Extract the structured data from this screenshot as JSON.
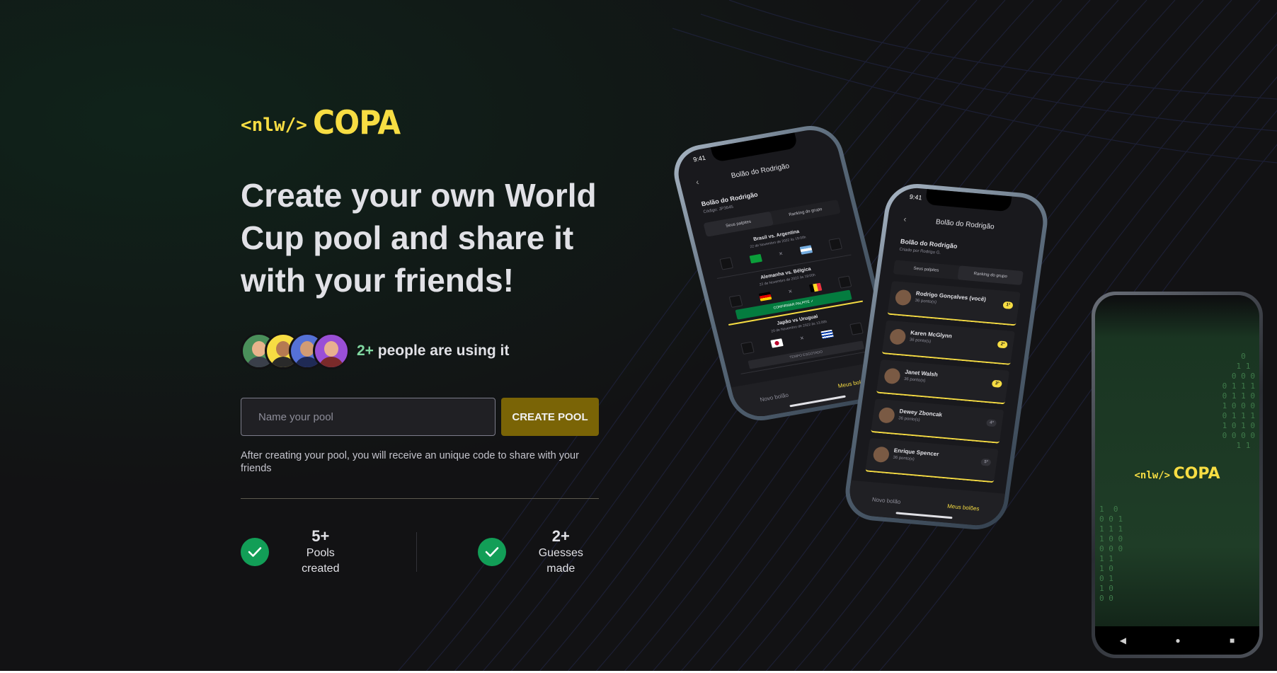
{
  "brand": {
    "prefix": "<nlw/>",
    "name": "COPA"
  },
  "headline": "Create your own World Cup pool and share it with your friends!",
  "users": {
    "count": "2+",
    "text": " people are using it"
  },
  "form": {
    "placeholder": "Name your pool",
    "button_label": "CREATE POOL",
    "hint": "After creating your pool, you will receive an unique code to share with your friends"
  },
  "stats": [
    {
      "value": "5+",
      "label": "Pools created"
    },
    {
      "value": "2+",
      "label": "Guesses made"
    }
  ],
  "colors": {
    "accent": "#F7DD43",
    "button": "#7A6406",
    "success": "#129E57",
    "background": "#121214"
  },
  "phone_left": {
    "time": "9:41",
    "title": "Bolão do Rodrigão",
    "pool_name": "Bolão do Rodrigão",
    "pool_code": "Código: JP3645",
    "tabs": [
      "Seus palpites",
      "Ranking do grupo"
    ],
    "games": [
      {
        "teams": "Brasil vs. Argentina",
        "date": "22 de Novembro de 2022 às 19:00h"
      },
      {
        "teams": "Alemanha vs. Bélgica",
        "date": "22 de Novembro de 2022 às 19:00h"
      },
      {
        "teams": "Japão vs Uruguai",
        "date": "20 de Novembro de 2022 às 13:00h"
      }
    ],
    "confirm_label": "CONFIRMAR PALPITE ✓",
    "expired_label": "TEMPO ESGOTADO",
    "nav": [
      "Novo bolão",
      "Meus bolões"
    ]
  },
  "phone_right": {
    "time": "9:41",
    "title": "Bolão do Rodrigão",
    "pool_name": "Bolão do Rodrigão",
    "pool_sub": "Criado por Rodrigo G.",
    "tabs": [
      "Seus palpites",
      "Ranking do grupo"
    ],
    "ranking": [
      {
        "name": "Rodrigo Gonçalves (você)",
        "points": "36 ponto(s)",
        "position": "1º"
      },
      {
        "name": "Karen McGlynn",
        "points": "36 ponto(s)",
        "position": "2º"
      },
      {
        "name": "Janet Walsh",
        "points": "36 ponto(s)",
        "position": "3º"
      },
      {
        "name": "Dewey Zboncak",
        "points": "36 ponto(s)",
        "position": "4º"
      },
      {
        "name": "Enrique Spencer",
        "points": "36 ponto(s)",
        "position": "5º"
      }
    ],
    "nav": [
      "Novo bolão",
      "Meus bolões"
    ]
  },
  "phone_android": {
    "brand_prefix": "<nlw/>",
    "brand_name": "COPA"
  }
}
